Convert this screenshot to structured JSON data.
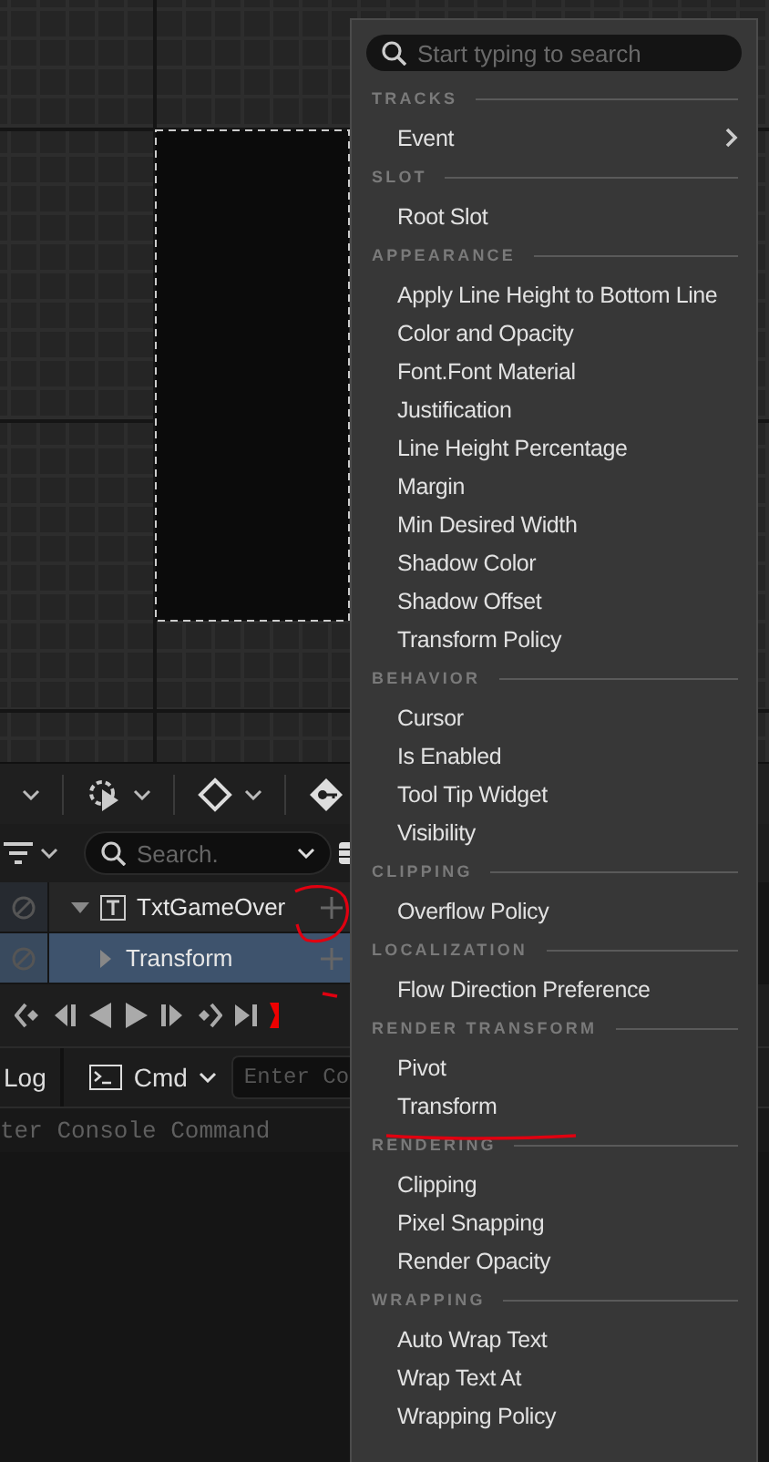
{
  "track_search": {
    "placeholder": "Search."
  },
  "tracks": [
    {
      "label": "TxtGameOver",
      "expanded": true,
      "selected": false,
      "children": [
        {
          "label": "Transform",
          "expanded": false,
          "selected": true
        }
      ]
    }
  ],
  "console": {
    "log_tab": "Log",
    "cmd_button": "Cmd",
    "input_placeholder": "Enter Co",
    "status_line": "ter Console Command"
  },
  "menu": {
    "search_placeholder": "Start typing to search",
    "sections": [
      {
        "heading": "TRACKS",
        "items": [
          {
            "label": "Event",
            "submenu": true
          }
        ]
      },
      {
        "heading": "SLOT",
        "items": [
          {
            "label": "Root Slot"
          }
        ]
      },
      {
        "heading": "APPEARANCE",
        "items": [
          {
            "label": "Apply Line Height to Bottom Line"
          },
          {
            "label": "Color and Opacity"
          },
          {
            "label": "Font.Font Material"
          },
          {
            "label": "Justification"
          },
          {
            "label": "Line Height Percentage"
          },
          {
            "label": "Margin"
          },
          {
            "label": "Min Desired Width"
          },
          {
            "label": "Shadow Color"
          },
          {
            "label": "Shadow Offset"
          },
          {
            "label": "Transform Policy"
          }
        ]
      },
      {
        "heading": "BEHAVIOR",
        "items": [
          {
            "label": "Cursor"
          },
          {
            "label": "Is Enabled"
          },
          {
            "label": "Tool Tip Widget"
          },
          {
            "label": "Visibility"
          }
        ]
      },
      {
        "heading": "CLIPPING",
        "items": [
          {
            "label": "Overflow Policy"
          }
        ]
      },
      {
        "heading": "LOCALIZATION",
        "items": [
          {
            "label": "Flow Direction Preference"
          }
        ]
      },
      {
        "heading": "RENDER TRANSFORM",
        "items": [
          {
            "label": "Pivot"
          },
          {
            "label": "Transform"
          }
        ]
      },
      {
        "heading": "RENDERING",
        "items": [
          {
            "label": "Clipping"
          },
          {
            "label": "Pixel Snapping"
          },
          {
            "label": "Render Opacity"
          }
        ]
      },
      {
        "heading": "WRAPPING",
        "items": [
          {
            "label": "Auto Wrap Text"
          },
          {
            "label": "Wrap Text At"
          },
          {
            "label": "Wrapping Policy"
          }
        ]
      }
    ]
  }
}
